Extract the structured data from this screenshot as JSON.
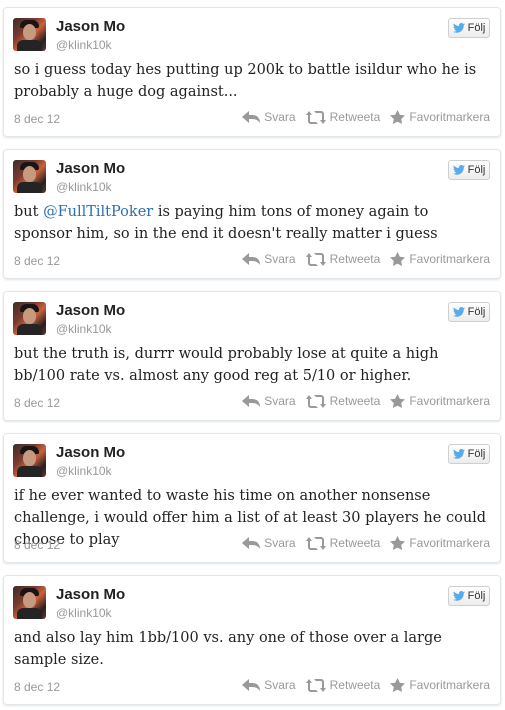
{
  "follow_label": "Följ",
  "actions": {
    "reply": "Svara",
    "retweet": "Retweeta",
    "favorite": "Favoritmarkera"
  },
  "icons": {
    "follow": "twitter-bird-icon",
    "reply": "reply-arrow-icon",
    "retweet": "retweet-icon",
    "favorite": "star-icon"
  },
  "colors": {
    "twitter_blue": "#55acee",
    "mention_blue": "#2a6fb0",
    "meta_gray": "#999999"
  },
  "tweets": [
    {
      "name": "Jason Mo",
      "handle": "@klink10k",
      "text": "so i guess today hes putting up 200k to battle isildur who he is probably a huge dog against...",
      "date": "8 dec 12"
    },
    {
      "name": "Jason Mo",
      "handle": "@klink10k",
      "text_before": "but ",
      "mention": "@FullTiltPoker",
      "text_after": " is paying him tons of money again to sponsor him, so in the end it doesn't really matter i guess",
      "date": "8 dec 12"
    },
    {
      "name": "Jason Mo",
      "handle": "@klink10k",
      "text": "but the truth is, durrr would probably lose at quite a high bb/100 rate vs. almost any good reg at 5/10 or higher.",
      "date": "8 dec 12"
    },
    {
      "name": "Jason Mo",
      "handle": "@klink10k",
      "text": "if he ever wanted to waste his time on another nonsense challenge, i would offer him a list of at least 30 players he could choose to play",
      "date": "8 dec 12"
    },
    {
      "name": "Jason Mo",
      "handle": "@klink10k",
      "text": "and also lay him 1bb/100 vs. any one of those over a large sample size.",
      "date": "8 dec 12"
    }
  ]
}
